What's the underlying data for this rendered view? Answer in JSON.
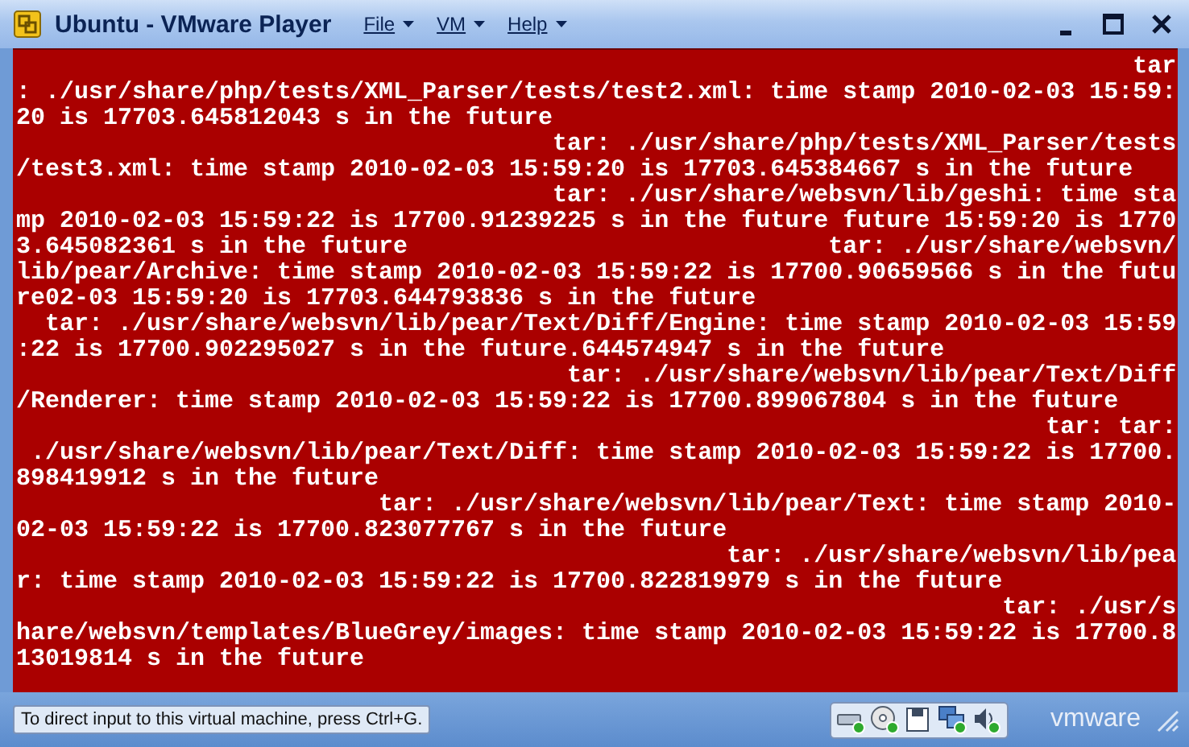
{
  "window": {
    "title": "Ubuntu - VMware Player",
    "menus": [
      {
        "label": "File"
      },
      {
        "label": "VM"
      },
      {
        "label": "Help"
      }
    ]
  },
  "console": {
    "lines": [
      "                                                                             tar",
      ": ./usr/share/php/tests/XML_Parser/tests/test2.xml: time stamp 2010-02-03 15:59:",
      "20 is 17703.645812043 s in the future",
      "                                     tar: ./usr/share/php/tests/XML_Parser/tests",
      "/test3.xml: time stamp 2010-02-03 15:59:20 is 17703.645384667 s in the future",
      "                                     tar: ./usr/share/websvn/lib/geshi: time sta",
      "mp 2010-02-03 15:59:22 is 17700.91239225 s in the future future 15:59:20 is 1770",
      "3.645082361 s in the future                             tar: ./usr/share/websvn/",
      "lib/pear/Archive: time stamp 2010-02-03 15:59:22 is 17700.90659566 s in the futu",
      "re02-03 15:59:20 is 17703.644793836 s in the future",
      "  tar: ./usr/share/websvn/lib/pear/Text/Diff/Engine: time stamp 2010-02-03 15:59",
      ":22 is 17700.902295027 s in the future.644574947 s in the future",
      "                                      tar: ./usr/share/websvn/lib/pear/Text/Diff",
      "/Renderer: time stamp 2010-02-03 15:59:22 is 17700.899067804 s in the future",
      "                                                                       tar: tar:",
      " ./usr/share/websvn/lib/pear/Text/Diff: time stamp 2010-02-03 15:59:22 is 17700.",
      "898419912 s in the future",
      "                         tar: ./usr/share/websvn/lib/pear/Text: time stamp 2010-",
      "02-03 15:59:22 is 17700.823077767 s in the future",
      "                                                 tar: ./usr/share/websvn/lib/pea",
      "r: time stamp 2010-02-03 15:59:22 is 17700.822819979 s in the future",
      "                                                                    tar: ./usr/s",
      "hare/websvn/templates/BlueGrey/images: time stamp 2010-02-03 15:59:22 is 17700.8",
      "13019814 s in the future"
    ]
  },
  "status_bar": {
    "message": "To direct input to this virtual machine, press Ctrl+G.",
    "logo": "vmware"
  }
}
